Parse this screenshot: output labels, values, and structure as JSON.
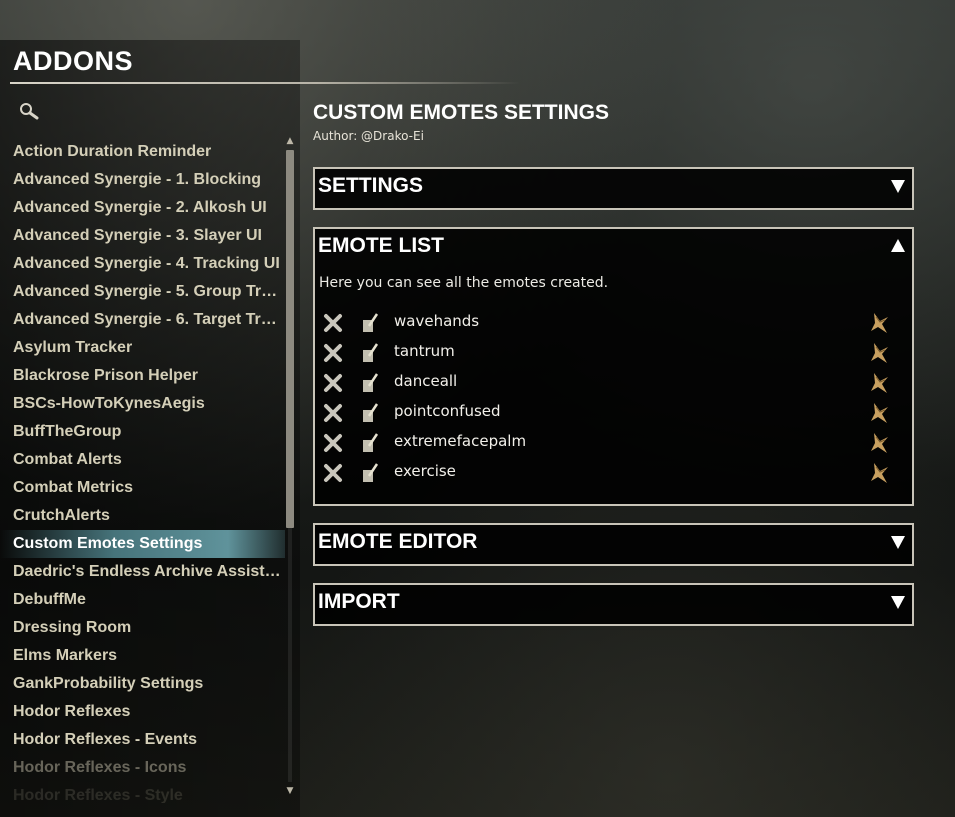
{
  "header": {
    "title": "ADDONS"
  },
  "sidebar": {
    "items": [
      {
        "label": "Action Duration Reminder"
      },
      {
        "label": "Advanced Synergie - 1. Blocking"
      },
      {
        "label": "Advanced Synergie - 2. Alkosh UI"
      },
      {
        "label": "Advanced Synergie - 3. Slayer UI"
      },
      {
        "label": "Advanced Synergie - 4. Tracking UI"
      },
      {
        "label": "Advanced Synergie - 5. Group Trac..."
      },
      {
        "label": "Advanced Synergie - 6. Target Trac..."
      },
      {
        "label": "Asylum Tracker"
      },
      {
        "label": "Blackrose Prison Helper"
      },
      {
        "label": "BSCs-HowToKynesAegis"
      },
      {
        "label": "BuffTheGroup"
      },
      {
        "label": "Combat Alerts"
      },
      {
        "label": "Combat Metrics"
      },
      {
        "label": "CrutchAlerts"
      },
      {
        "label": "Custom Emotes Settings"
      },
      {
        "label": "Daedric's Endless Archive Assistant"
      },
      {
        "label": "DebuffMe"
      },
      {
        "label": "Dressing Room"
      },
      {
        "label": "Elms Markers"
      },
      {
        "label": "GankProbability Settings"
      },
      {
        "label": "Hodor Reflexes"
      },
      {
        "label": "Hodor Reflexes - Events"
      },
      {
        "label": "Hodor Reflexes - Icons"
      },
      {
        "label": "Hodor Reflexes - Style"
      }
    ],
    "selected": "Custom Emotes Settings"
  },
  "panel": {
    "title": "CUSTOM EMOTES SETTINGS",
    "author": "Author: @Drako-Ei",
    "sections": {
      "settings": {
        "label": "SETTINGS",
        "state": "collapsed"
      },
      "emote_list": {
        "label": "EMOTE LIST",
        "state": "expanded",
        "description": "Here you can see all the emotes created.",
        "emotes": [
          "wavehands",
          "tantrum",
          "danceall",
          "pointconfused",
          "extremefacepalm",
          "exercise"
        ]
      },
      "emote_editor": {
        "label": "EMOTE EDITOR",
        "state": "collapsed"
      },
      "import": {
        "label": "IMPORT",
        "state": "collapsed"
      }
    }
  },
  "icons": {
    "search": "search-icon",
    "delete": "delete-icon",
    "edit": "edit-icon",
    "play": "play-emote-icon",
    "expand": "chevron-down-icon",
    "collapse": "chevron-up-icon"
  },
  "colors": {
    "selected_highlight": "#6aaab4",
    "panel_border": "#c8c4b8",
    "addon_text": "#d4cfb8"
  }
}
